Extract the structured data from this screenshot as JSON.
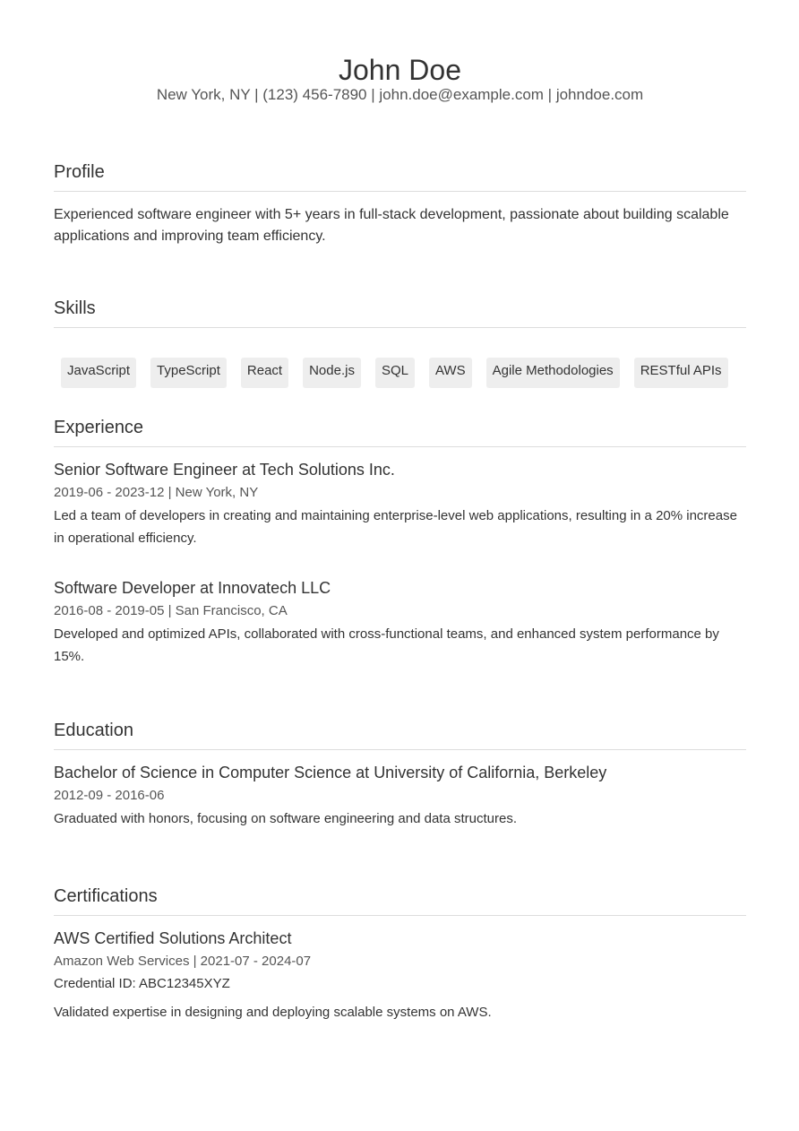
{
  "header": {
    "name": "John Doe",
    "contact": "New York, NY | (123) 456-7890 | john.doe@example.com | johndoe.com"
  },
  "profile": {
    "title": "Profile",
    "text": "Experienced software engineer with 5+ years in full-stack development, passionate about building scalable applications and improving team efficiency."
  },
  "skills": {
    "title": "Skills",
    "items": [
      "JavaScript",
      "TypeScript",
      "React",
      "Node.js",
      "SQL",
      "AWS",
      "Agile Methodologies",
      "RESTful APIs"
    ]
  },
  "experience": {
    "title": "Experience",
    "items": [
      {
        "title": "Senior Software Engineer at Tech Solutions Inc.",
        "meta": "2019-06 - 2023-12 | New York, NY",
        "desc": "Led a team of developers in creating and maintaining enterprise-level web applications, resulting in a 20% increase in operational efficiency."
      },
      {
        "title": "Software Developer at Innovatech LLC",
        "meta": "2016-08 - 2019-05 | San Francisco, CA",
        "desc": "Developed and optimized APIs, collaborated with cross-functional teams, and enhanced system performance by 15%."
      }
    ]
  },
  "education": {
    "title": "Education",
    "items": [
      {
        "title": "Bachelor of Science in Computer Science at University of California, Berkeley",
        "meta": "2012-09 - 2016-06",
        "desc": "Graduated with honors, focusing on software engineering and data structures."
      }
    ]
  },
  "certifications": {
    "title": "Certifications",
    "items": [
      {
        "title": "AWS Certified Solutions Architect",
        "meta": "Amazon Web Services | 2021-07 - 2024-07",
        "credential": "Credential ID: ABC12345XYZ",
        "desc": "Validated expertise in designing and deploying scalable systems on AWS."
      }
    ]
  }
}
